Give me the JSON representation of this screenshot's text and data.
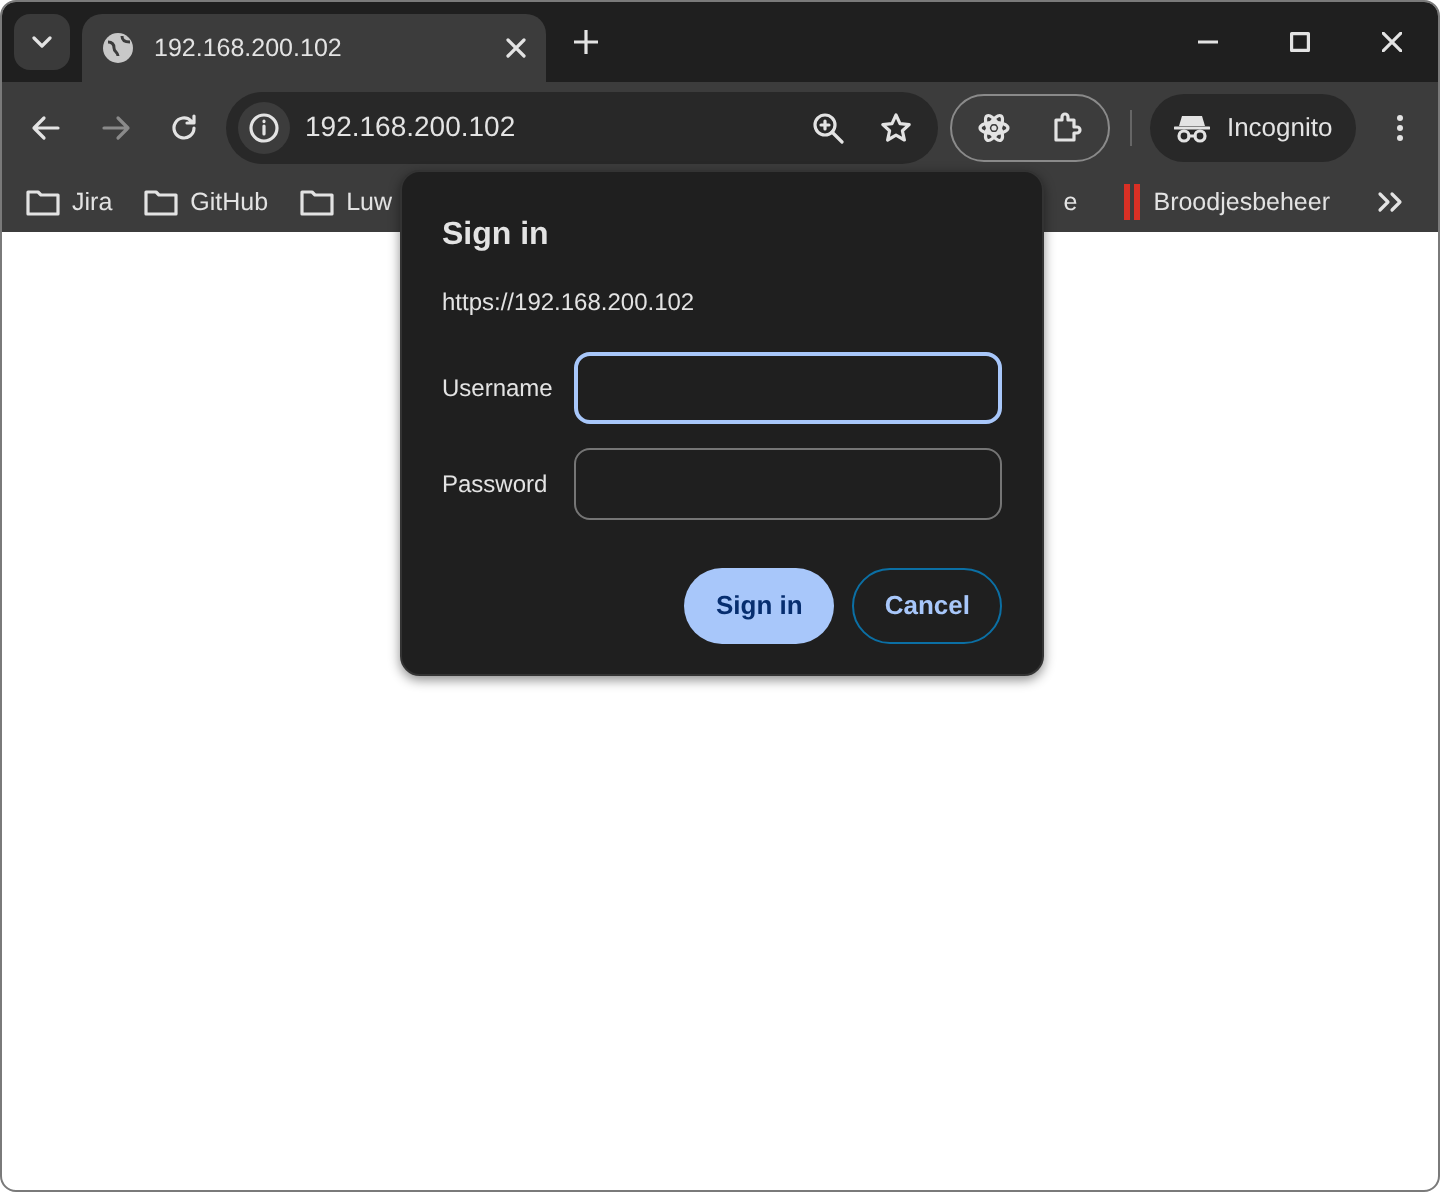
{
  "tab": {
    "title": "192.168.200.102",
    "selected": true
  },
  "address": {
    "url": "192.168.200.102"
  },
  "profile": {
    "label": "Incognito"
  },
  "bookmarks_left": [
    {
      "label": "Jira",
      "kind": "folder"
    },
    {
      "label": "GitHub",
      "kind": "folder"
    },
    {
      "label": "Luw",
      "kind": "folder"
    }
  ],
  "bookmarks_right": [
    {
      "label": "e",
      "kind": "text"
    },
    {
      "label": "Broodjesbeheer",
      "kind": "bars"
    }
  ],
  "dialog": {
    "title": "Sign in",
    "origin": "https://192.168.200.102",
    "fields": [
      {
        "label": "Username",
        "focused": true
      },
      {
        "label": "Password",
        "focused": false
      }
    ],
    "buttons": [
      {
        "label": "Sign in",
        "kind": "primary"
      },
      {
        "label": "Cancel",
        "kind": "secondary"
      }
    ]
  }
}
